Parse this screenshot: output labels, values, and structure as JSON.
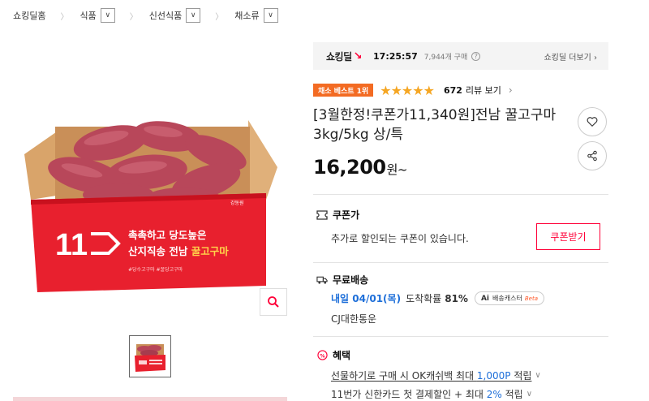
{
  "breadcrumb": {
    "home": "쇼킹딜홈",
    "cat1": "식품",
    "cat2": "신선식품",
    "cat3": "채소류"
  },
  "deal": {
    "logo": "쇼킹딜",
    "time": "17:25:57",
    "count": "7,944개 구매",
    "more": "쇼킹딜 더보기 ›"
  },
  "rating": {
    "badge": "채소 베스트 1위",
    "stars": "★★★★★",
    "score": 4.5,
    "review_count": "672",
    "review_label": "리뷰 보기"
  },
  "product": {
    "title": "[3월한정!쿠폰가11,340원]전남 꿀고구마 3kg/5kg 상/특",
    "price": "16,200",
    "price_unit": "원~",
    "box_logo": "11",
    "box_text1": "촉촉하고 당도높은",
    "box_text2": "산지직송 전남 ",
    "box_text2_hl": "꿀고구마",
    "box_tag": "#당수고구마 #꿀당고구마",
    "box_brand": "강동원"
  },
  "coupon": {
    "heading": "쿠폰가",
    "text": "추가로 할인되는 쿠폰이 있습니다.",
    "button": "쿠폰받기"
  },
  "shipping": {
    "heading": "무료배송",
    "date": "내일 04/01(목)",
    "prob_label": "도착확률",
    "prob": "81%",
    "ai_label": "Ai",
    "ai_text": "배송캐스터",
    "ai_beta": "Beta",
    "carrier": "CJ대한통운"
  },
  "benefit": {
    "heading": "혜택",
    "line1_pre": "선물하기로 구매 시 OK캐쉬백 최대 ",
    "line1_amt": "1,000P",
    "line1_post": " 적립",
    "line2_pre": "11번가 신한카드 첫 결제할인 + 최대 ",
    "line2_amt": "2%",
    "line2_post": " 적립"
  },
  "colors": {
    "brand_red": "#ff0038",
    "badge_orange": "#f36b23",
    "star": "#f5a623",
    "link_blue": "#1e6fd9"
  }
}
